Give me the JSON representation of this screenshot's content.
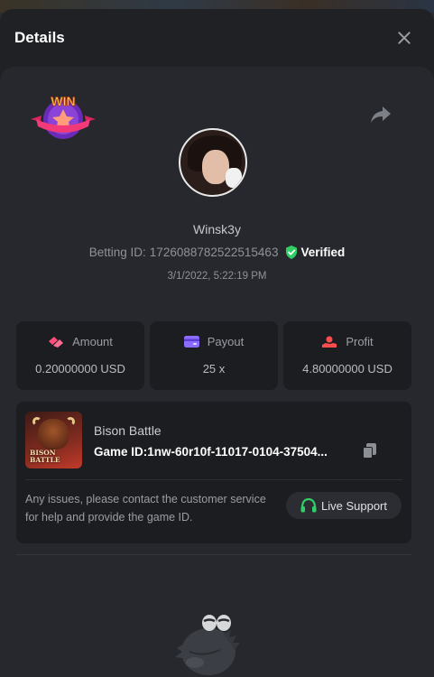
{
  "window": {
    "title": "Details"
  },
  "bet": {
    "username": "Winsk3y",
    "betting_id_label": "Betting ID:",
    "betting_id": "1726088782522515463",
    "verified_label": "Verified",
    "date": "3/1/2022, 5:22:19 PM",
    "badge_text": "WIN"
  },
  "stats": {
    "amount_label": "Amount",
    "amount_value": "0.20000000 USD",
    "payout_label": "Payout",
    "payout_value": "25 x",
    "profit_label": "Profit",
    "profit_value": "4.80000000 USD"
  },
  "game": {
    "name": "Bison Battle",
    "id_text": "Game ID:1nw-60r10f-11017-0104-37504...",
    "thumb_text": "BISON BATTLE",
    "issue_text": "Any issues, please contact the customer service for help and provide the game ID.",
    "support_label": "Live Support"
  },
  "colors": {
    "accent_pink": "#ff4d7a",
    "accent_purple": "#8c6cff",
    "accent_red": "#ff4d4d",
    "verified_green": "#2fcf65"
  },
  "icons": [
    "close-icon",
    "share-icon",
    "amount-icon",
    "payout-icon",
    "profit-icon",
    "copy-icon",
    "headset-icon",
    "shield-check-icon"
  ]
}
